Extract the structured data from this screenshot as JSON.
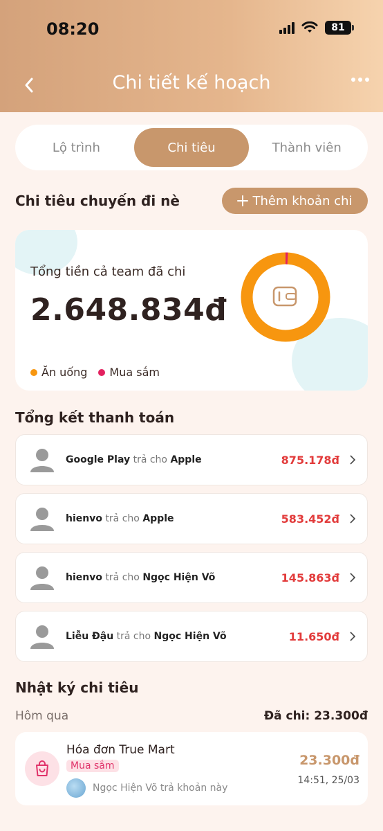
{
  "status_bar": {
    "time": "08:20",
    "battery": "81"
  },
  "header": {
    "title": "Chi tiết kế hoạch"
  },
  "tabs": [
    {
      "label": "Lộ trình",
      "active": false
    },
    {
      "label": "Chi tiêu",
      "active": true
    },
    {
      "label": "Thành viên",
      "active": false
    }
  ],
  "expenses_section": {
    "title": "Chi tiêu chuyến đi nè",
    "add_button": "Thêm khoản chi"
  },
  "summary": {
    "label": "Tổng tiền cả team đã chi",
    "total": "2.648.834đ",
    "legend": [
      {
        "label": "Ăn uống",
        "color": "#f7960f"
      },
      {
        "label": "Mua sắm",
        "color": "#e3215f"
      }
    ],
    "donut_share": {
      "an_uong": 0.991,
      "mua_sam": 0.009
    }
  },
  "settlement": {
    "title": "Tổng kết thanh toán",
    "rows": [
      {
        "from": "Google Play",
        "verb": "trả cho",
        "to": "Apple",
        "amount": "875.178đ"
      },
      {
        "from": "hienvo",
        "verb": "trả cho",
        "to": "Apple",
        "amount": "583.452đ"
      },
      {
        "from": "hienvo",
        "verb": "trả cho",
        "to": "Ngọc Hiện Võ",
        "amount": "145.863đ"
      },
      {
        "from": "Liễu Đậu",
        "verb": "trả cho",
        "to": "Ngọc Hiện Võ",
        "amount": "11.650đ"
      }
    ]
  },
  "log": {
    "title": "Nhật ký chi tiêu",
    "day_label": "Hôm qua",
    "day_spent": "Đã chi: 23.300đ",
    "entries": [
      {
        "title": "Hóa đơn True Mart",
        "tag": "Mua sắm",
        "payer_text": "Ngọc Hiện Võ trả khoản này",
        "amount": "23.300đ",
        "time": "14:51, 25/03"
      }
    ]
  }
}
